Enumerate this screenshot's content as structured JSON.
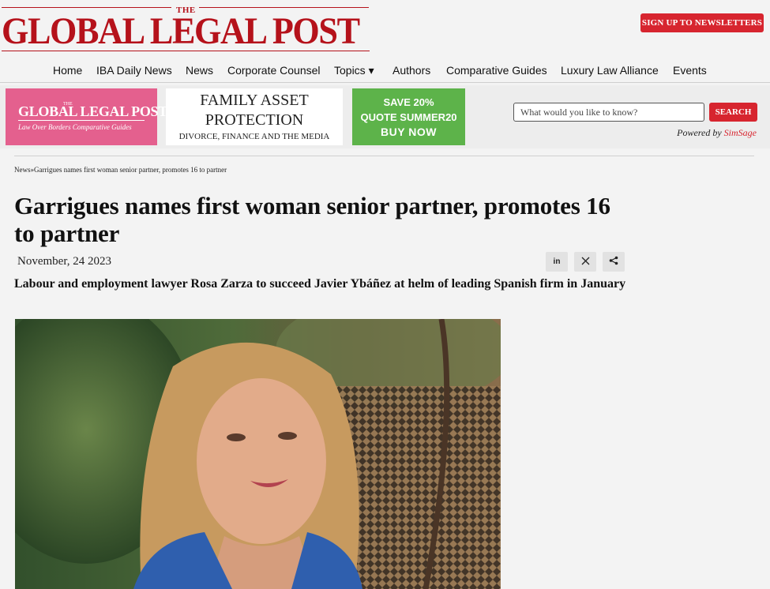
{
  "masthead": {
    "the": "THE",
    "title": "GLOBAL LEGAL POST",
    "newsletter_button": "SIGN UP TO NEWSLETTERS"
  },
  "nav": {
    "items": [
      {
        "label": "Home"
      },
      {
        "label": "IBA Daily News"
      },
      {
        "label": "News"
      },
      {
        "label": "Corporate Counsel"
      },
      {
        "label": "Topics ▾"
      },
      {
        "label": "Authors"
      },
      {
        "label": "Comparative Guides"
      },
      {
        "label": "Luxury Law Alliance"
      },
      {
        "label": "Events"
      }
    ]
  },
  "ads": {
    "glp_guides": {
      "the": "THE",
      "title": "GLOBAL LEGAL POST",
      "subtitle": "Law Over Borders Comparative Guides"
    },
    "family": {
      "line1": "FAMILY ASSET",
      "line2": "PROTECTION",
      "line3": "DIVORCE, FINANCE AND THE MEDIA"
    },
    "promo": {
      "line1": "SAVE 20%",
      "line2": "QUOTE SUMMER20",
      "line3": "BUY NOW"
    }
  },
  "search": {
    "placeholder": "What would you like to know?",
    "button": "SEARCH",
    "powered_prefix": "Powered by",
    "powered_brand": "SimSage"
  },
  "article": {
    "breadcrumb_section": "News",
    "breadcrumb_sep": "»",
    "breadcrumb_title": "Garrigues names first woman senior partner, promotes 16 to partner",
    "headline": "Garrigues names first woman senior partner, promotes 16 to partner",
    "date": "November, 24 2023",
    "standfirst": "Labour and employment lawyer Rosa Zarza to succeed Javier Ybáñez at helm of leading Spanish firm in January"
  },
  "share": {
    "linkedin": "in",
    "x": "𝕏"
  },
  "colors": {
    "brand_red": "#b5121b",
    "button_red": "#d7252f",
    "ad_pink": "#e4608e",
    "ad_green": "#5db34a"
  },
  "icons": [
    "linkedin-icon",
    "x-icon",
    "share-icon"
  ]
}
